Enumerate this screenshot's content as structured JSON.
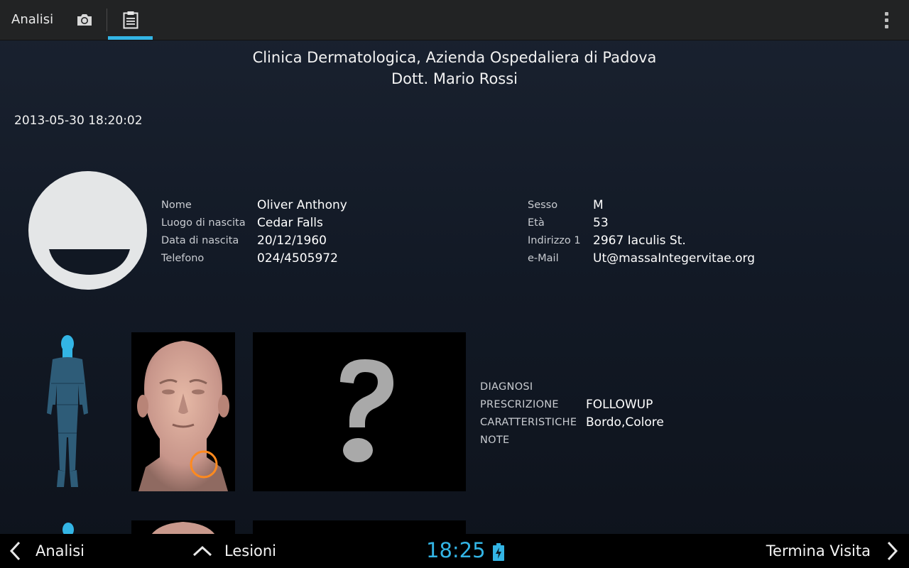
{
  "actionbar": {
    "title": "Analisi",
    "tabs": [
      {
        "name": "camera",
        "icon": "camera-icon",
        "selected": false
      },
      {
        "name": "report",
        "icon": "clipboard-icon",
        "selected": true
      }
    ],
    "overflow_icon": "overflow-menu-icon"
  },
  "header": {
    "clinic": "Clinica Dermatologica, Azienda Ospedaliera di Padova",
    "doctor": "Dott. Mario Rossi"
  },
  "visit_date": "2013-05-30 18:20:02",
  "patient": {
    "avatar_icon": "patient-avatar-icon",
    "left": [
      {
        "label": "Nome",
        "value": "Oliver Anthony"
      },
      {
        "label": "Luogo di nascita",
        "value": "Cedar Falls"
      },
      {
        "label": "Data di nascita",
        "value": "20/12/1960"
      },
      {
        "label": "Telefono",
        "value": "024/4505972"
      }
    ],
    "right": [
      {
        "label": "Sesso",
        "value": "M"
      },
      {
        "label": "Età",
        "value": "53"
      },
      {
        "label": "Indirizzo 1",
        "value": "2967 Iaculis St."
      },
      {
        "label": "e-Mail",
        "value": "Ut@massaIntegervitae.org"
      }
    ]
  },
  "lesion": {
    "location_icon": "body-figure-icon",
    "face_image_icon": "head-model-icon",
    "photo_placeholder_icon": "question-mark-icon",
    "fields": [
      {
        "label": "DIAGNOSI",
        "value": ""
      },
      {
        "label": "PRESCRIZIONE",
        "value": "FOLLOWUP"
      },
      {
        "label": "CARATTERISTICHE",
        "value": "Bordo,Colore"
      },
      {
        "label": "NOTE",
        "value": ""
      }
    ]
  },
  "navbar": {
    "back_label": "Analisi",
    "lesioni_label": "Lesioni",
    "time": "18:25",
    "finish_label": "Termina Visita"
  },
  "colors": {
    "accent": "#33b5e5",
    "marker": "#ff8a1e",
    "body_figure": "#2e5c78"
  }
}
